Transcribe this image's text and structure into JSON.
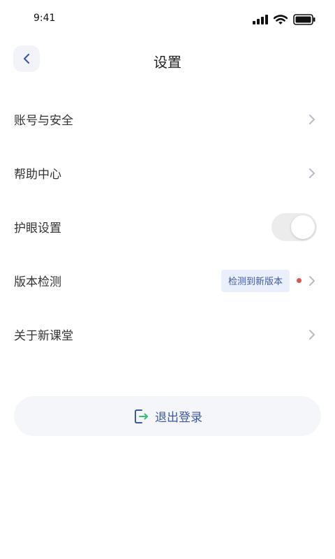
{
  "status_bar": {
    "time": "9:41",
    "icons": [
      "signal-icon",
      "wifi-icon",
      "battery-icon"
    ]
  },
  "header": {
    "title": "设置",
    "back_icon": "chevron-left-icon"
  },
  "settings": {
    "account": {
      "label": "账号与安全"
    },
    "help": {
      "label": "帮助中心"
    },
    "eye_care": {
      "label": "护眼设置",
      "toggle_on": false
    },
    "version": {
      "label": "版本检测",
      "badge": "检测到新版本",
      "has_update_dot": true
    },
    "about": {
      "label": "关于新课堂"
    }
  },
  "logout": {
    "label": "退出登录",
    "icon": "logout-icon"
  },
  "colors": {
    "accent": "#3c5aa6",
    "logout_icon_green": "#2fbf71",
    "dot_red": "#e2544b",
    "badge_bg": "#eaf0fb",
    "chevron": "#b8bccb"
  }
}
